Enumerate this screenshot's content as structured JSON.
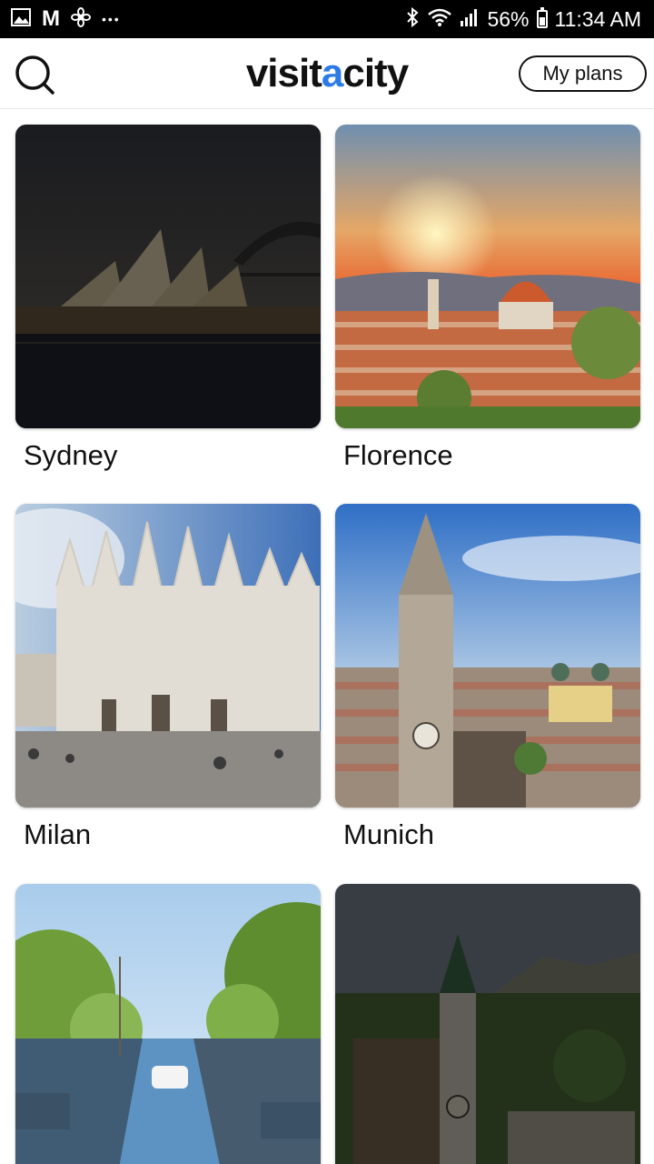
{
  "status_bar": {
    "left_icons": [
      "image-icon",
      "gmail-icon",
      "fan-icon",
      "more-dots-icon"
    ],
    "right_icons": [
      "bluetooth-icon",
      "wifi-icon",
      "signal-icon",
      "battery-icon"
    ],
    "gmail_letter": "M",
    "more_dots": "•••",
    "battery_percent": "56%",
    "battery_level": 0.56,
    "time": "11:34 AM"
  },
  "header": {
    "logo_part1": "visit",
    "logo_accent": "a",
    "logo_part2": "city",
    "my_plans_label": "My plans",
    "search_icon": "search-icon"
  },
  "colors": {
    "logo_accent": "#2c7be5",
    "status_bar_bg": "#000000",
    "page_bg": "#ffffff"
  },
  "cities": [
    {
      "name": "Sydney",
      "dimmed": true
    },
    {
      "name": "Florence",
      "dimmed": false
    },
    {
      "name": "Milan",
      "dimmed": false
    },
    {
      "name": "Munich",
      "dimmed": false
    },
    {
      "name": "",
      "dimmed": false
    },
    {
      "name": "",
      "dimmed": true
    }
  ]
}
